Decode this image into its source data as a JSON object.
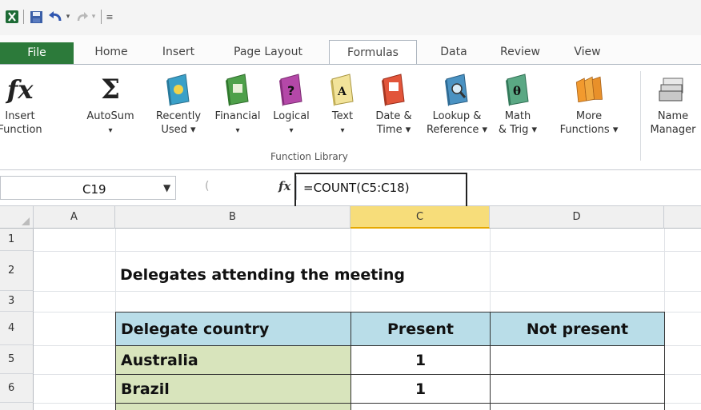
{
  "qat": {
    "excel_icon": "excel-logo-icon",
    "save_icon": "save-icon",
    "undo_icon": "undo-icon",
    "redo_icon": "redo-icon",
    "customize_icon": "customize-qat-icon"
  },
  "tabs": [
    "File",
    "Home",
    "Insert",
    "Page Layout",
    "Formulas",
    "Data",
    "Review",
    "View"
  ],
  "active_tab": "Formulas",
  "ribbon": {
    "buttons": [
      {
        "line1": "Insert",
        "line2": "Function"
      },
      {
        "line1": "AutoSum",
        "line2": "▾"
      },
      {
        "line1": "Recently",
        "line2": "Used ▾"
      },
      {
        "line1": "Financial",
        "line2": "▾"
      },
      {
        "line1": "Logical",
        "line2": "▾"
      },
      {
        "line1": "Text",
        "line2": "▾"
      },
      {
        "line1": "Date &",
        "line2": "Time ▾"
      },
      {
        "line1": "Lookup &",
        "line2": "Reference ▾"
      },
      {
        "line1": "Math",
        "line2": "& Trig ▾"
      },
      {
        "line1": "More",
        "line2": "Functions ▾"
      },
      {
        "line1": "Name",
        "line2": "Manager"
      }
    ],
    "group_label": "Function Library"
  },
  "formula_bar": {
    "name_box": "C19",
    "formula": "=COUNT(C5:C18)"
  },
  "grid": {
    "columns": [
      "A",
      "B",
      "C",
      "D"
    ],
    "rows": [
      "1",
      "2",
      "3",
      "4",
      "5",
      "6"
    ],
    "title": "Delegates attending the meeting",
    "headers": [
      "Delegate country",
      "Present",
      "Not present"
    ],
    "data": [
      {
        "country": "Australia",
        "present": "1",
        "not_present": ""
      },
      {
        "country": "Brazil",
        "present": "1",
        "not_present": ""
      }
    ]
  },
  "colors": {
    "file_tab": "#2c7a3a",
    "header_fill": "#b9dde8",
    "country_fill": "#d8e4bc",
    "selected_column": "#f7dd7a"
  }
}
